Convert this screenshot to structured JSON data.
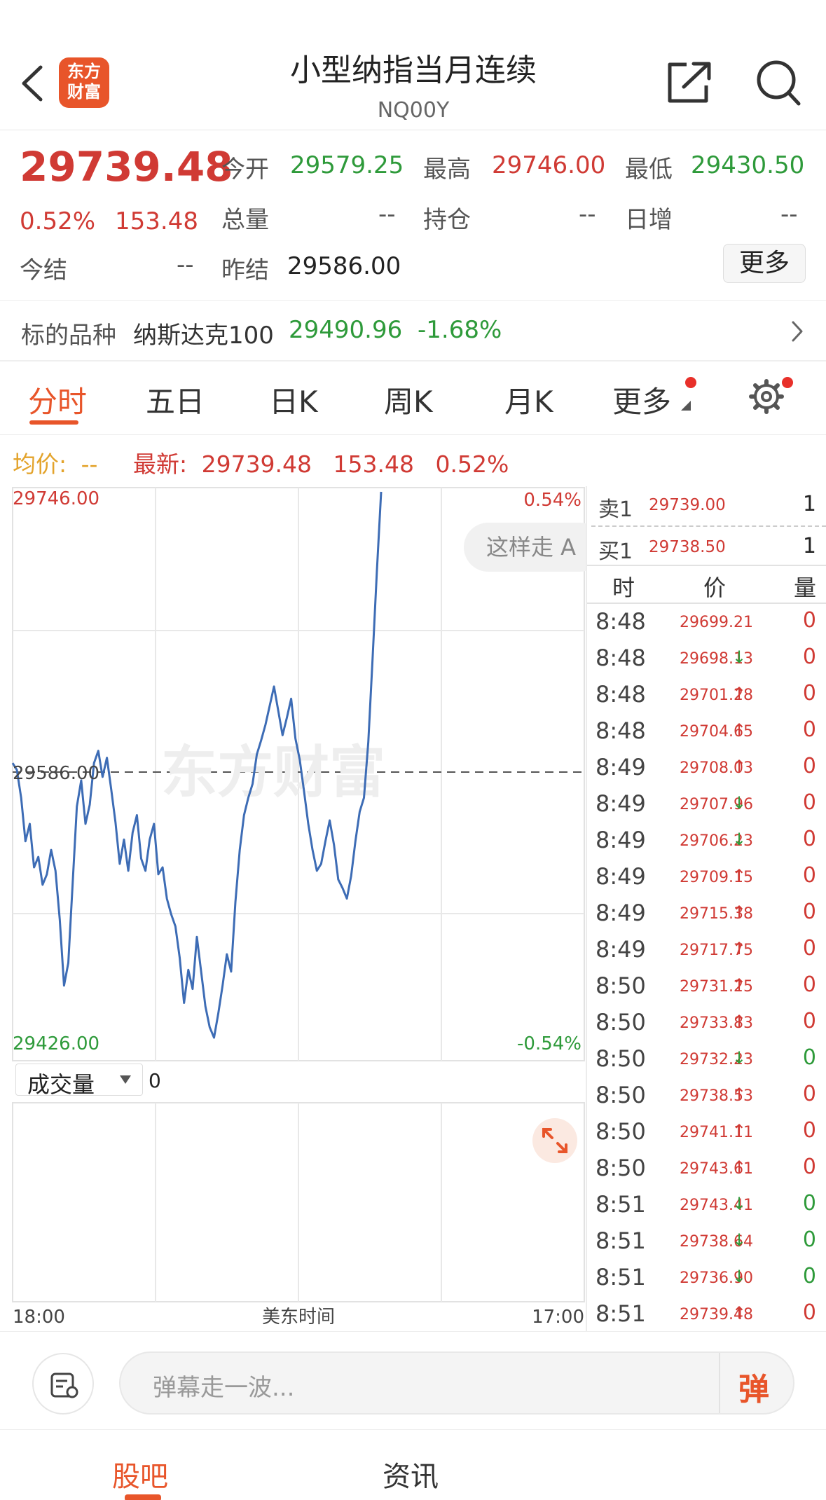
{
  "header": {
    "logo_line1": "东方",
    "logo_line2": "财富",
    "title": "小型纳指当月连续",
    "symbol": "NQ00Y"
  },
  "quote": {
    "price": "29739.48",
    "change_pct": "0.52%",
    "change": "153.48",
    "open_label": "今开",
    "open": "29579.25",
    "high_label": "最高",
    "high": "29746.00",
    "low_label": "最低",
    "low": "29430.50",
    "volume_label": "总量",
    "volume": "--",
    "oi_label": "持仓",
    "oi": "--",
    "daily_inc_label": "日增",
    "daily_inc": "--",
    "settle_label": "今结",
    "settle": "--",
    "prev_settle_label": "昨结",
    "prev_settle": "29586.00",
    "more_label": "更多"
  },
  "underlying": {
    "label": "标的品种",
    "name": "纳斯达克100",
    "price": "29490.96",
    "change_pct": "-1.68%"
  },
  "tabs": [
    "分时",
    "五日",
    "日K",
    "周K",
    "月K",
    "更多"
  ],
  "info_line": {
    "avg_label": "均价:",
    "avg": "--",
    "latest_label": "最新:",
    "latest": "29739.48",
    "change": "153.48",
    "change_pct": "0.52%"
  },
  "chart_labels": {
    "y_top": "29746.00",
    "y_mid": "29586.00",
    "y_bottom": "29426.00",
    "pct_top": "0.54%",
    "pct_bottom": "-0.54%",
    "x_start": "18:00",
    "x_mid": "美东时间",
    "x_end": "17:00",
    "volume_label": "成交量",
    "volume_value": "0",
    "watermark": "东方财富",
    "danmaku_bubble": "这样走 A"
  },
  "chart_data": {
    "type": "line",
    "ylim": [
      29426.0,
      29746.0
    ],
    "reference": 29586.0,
    "x_start_label": "18:00",
    "x_end_label": "17:00",
    "series": [
      {
        "values": [
          29590,
          29586,
          29570,
          29545,
          29555,
          29530,
          29536,
          29520,
          29526,
          29540,
          29528,
          29500,
          29462,
          29475,
          29520,
          29565,
          29580,
          29555,
          29566,
          29590,
          29597,
          29582,
          29593,
          29575,
          29556,
          29532,
          29546,
          29528,
          29550,
          29560,
          29535,
          29528,
          29546,
          29555,
          29526,
          29530,
          29512,
          29503,
          29496,
          29478,
          29452,
          29471,
          29460,
          29490,
          29470,
          29450,
          29438,
          29432,
          29446,
          29462,
          29480,
          29470,
          29510,
          29540,
          29560,
          29570,
          29578,
          29595,
          29603,
          29612,
          29623,
          29634,
          29620,
          29606,
          29616,
          29627,
          29604,
          29592,
          29574,
          29555,
          29540,
          29528,
          29532,
          29545,
          29557,
          29543,
          29523,
          29518,
          29512,
          29525,
          29545,
          29562,
          29570,
          29602,
          29650,
          29700,
          29746
        ]
      }
    ]
  },
  "order_book": {
    "sell1_label": "卖1",
    "sell1_price": "29739.00",
    "sell1_vol": "1",
    "buy1_label": "买1",
    "buy1_price": "29738.50",
    "buy1_vol": "1"
  },
  "ticks_header": {
    "time": "时",
    "price": "价",
    "vol": "量"
  },
  "ticks": [
    {
      "time": "8:48",
      "price": "29699.21",
      "dir": "",
      "vol": "0",
      "vol_color": "red"
    },
    {
      "time": "8:48",
      "price": "29698.13",
      "dir": "↓",
      "vol": "0",
      "vol_color": "red"
    },
    {
      "time": "8:48",
      "price": "29701.28",
      "dir": "↑",
      "vol": "0",
      "vol_color": "red"
    },
    {
      "time": "8:48",
      "price": "29704.65",
      "dir": "↑",
      "vol": "0",
      "vol_color": "red"
    },
    {
      "time": "8:49",
      "price": "29708.03",
      "dir": "↑",
      "vol": "0",
      "vol_color": "red"
    },
    {
      "time": "8:49",
      "price": "29707.96",
      "dir": "↓",
      "vol": "0",
      "vol_color": "red"
    },
    {
      "time": "8:49",
      "price": "29706.23",
      "dir": "↓",
      "vol": "0",
      "vol_color": "red"
    },
    {
      "time": "8:49",
      "price": "29709.15",
      "dir": "↑",
      "vol": "0",
      "vol_color": "red"
    },
    {
      "time": "8:49",
      "price": "29715.38",
      "dir": "↑",
      "vol": "0",
      "vol_color": "red"
    },
    {
      "time": "8:49",
      "price": "29717.75",
      "dir": "↑",
      "vol": "0",
      "vol_color": "red"
    },
    {
      "time": "8:50",
      "price": "29731.25",
      "dir": "↑",
      "vol": "0",
      "vol_color": "red"
    },
    {
      "time": "8:50",
      "price": "29733.83",
      "dir": "↑",
      "vol": "0",
      "vol_color": "red"
    },
    {
      "time": "8:50",
      "price": "29732.23",
      "dir": "↓",
      "vol": "0",
      "vol_color": "green"
    },
    {
      "time": "8:50",
      "price": "29738.53",
      "dir": "↑",
      "vol": "0",
      "vol_color": "red"
    },
    {
      "time": "8:50",
      "price": "29741.11",
      "dir": "↑",
      "vol": "0",
      "vol_color": "red"
    },
    {
      "time": "8:50",
      "price": "29743.61",
      "dir": "↑",
      "vol": "0",
      "vol_color": "red"
    },
    {
      "time": "8:51",
      "price": "29743.41",
      "dir": "↓",
      "vol": "0",
      "vol_color": "green"
    },
    {
      "time": "8:51",
      "price": "29738.64",
      "dir": "↓",
      "vol": "0",
      "vol_color": "green"
    },
    {
      "time": "8:51",
      "price": "29736.90",
      "dir": "↓",
      "vol": "0",
      "vol_color": "green"
    },
    {
      "time": "8:51",
      "price": "29739.48",
      "dir": "↑",
      "vol": "0",
      "vol_color": "red"
    }
  ],
  "comment": {
    "placeholder": "弹幕走一波...",
    "send_label": "弹"
  },
  "bottom_nav": [
    "股吧",
    "资讯"
  ],
  "colors": {
    "up": "#d03a34",
    "down": "#2e9a3a",
    "accent": "#e8552a",
    "line": "#3d6cb5"
  }
}
